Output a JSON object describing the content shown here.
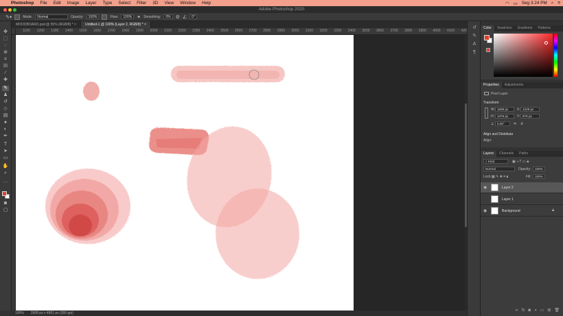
{
  "menubar": {
    "app": "Photoshop",
    "items": [
      "File",
      "Edit",
      "Image",
      "Layer",
      "Type",
      "Select",
      "Filter",
      "3D",
      "View",
      "Window",
      "Help"
    ],
    "clock": "Seg 3:24 PM"
  },
  "window": {
    "title": "Adobe Photoshop 2020"
  },
  "options_bar": {
    "mode_label": "Mode:",
    "mode_value": "Normal",
    "opacity_label": "Opacity:",
    "opacity_value": "100%",
    "flow_label": "Flow:",
    "flow_value": "100%",
    "smoothing_label": "Smoothing:",
    "smoothing_value": "0%",
    "angle_value": "0°"
  },
  "doc_tabs": [
    {
      "label": "MOODBOARD.psd @ 55% (RGB/8) *",
      "active": false
    },
    {
      "label": "Untitled-1 @ 100% (Layer 2, RGB/8) *",
      "active": true
    }
  ],
  "ruler_ticks": [
    "1100",
    "1200",
    "1300",
    "1400",
    "1500",
    "1600",
    "1700",
    "1800",
    "1900",
    "2000",
    "2100",
    "2200",
    "2300",
    "2400",
    "2500",
    "2600",
    "2700",
    "2800",
    "2900",
    "3000",
    "3100",
    "3200",
    "3300",
    "3400",
    "3500",
    "3600",
    "3700",
    "3800",
    "3900",
    "4000",
    "4100",
    "4200"
  ],
  "status_bar": {
    "zoom": "100%",
    "doc_info": "3508 px x 4961 px (300 ppi)"
  },
  "color_panel": {
    "tabs": [
      "Color",
      "Swatches",
      "Gradients",
      "Patterns"
    ],
    "hue_color": "#ff2a2a",
    "foreground": "#e0402c",
    "background": "#ffffff"
  },
  "properties_panel": {
    "tabs": [
      "Properties",
      "Adjustments"
    ],
    "kind": "Pixel Layer",
    "transform_label": "Transform",
    "w_label": "W:",
    "w_value": "1669 px",
    "x_label": "X:",
    "x_value": "1229 px",
    "h_label": "H:",
    "h_value": "1376 px",
    "y_label": "Y:",
    "y_value": "876 px",
    "angle_value": "0,00°",
    "align_label": "Align and Distribute",
    "align_sub": "Align:"
  },
  "layers_panel": {
    "tabs": [
      "Layers",
      "Channels",
      "Paths"
    ],
    "filter": "Kind",
    "blend_mode": "Normal",
    "opacity_label": "Opacity:",
    "opacity_value": "100%",
    "lock_label": "Lock:",
    "fill_label": "Fill:",
    "fill_value": "100%",
    "layers": [
      {
        "name": "Layer 2",
        "selected": true
      },
      {
        "name": "Layer 1",
        "selected": false
      },
      {
        "name": "Background",
        "selected": false
      }
    ]
  }
}
